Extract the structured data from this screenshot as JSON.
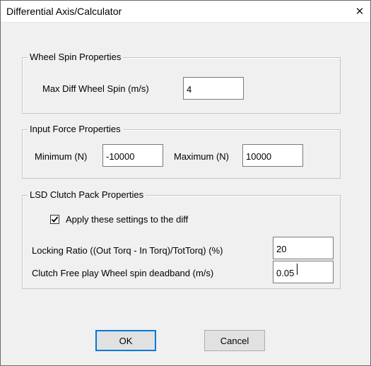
{
  "window": {
    "title": "Differential Axis/Calculator",
    "close_glyph": "✕"
  },
  "wheel_spin": {
    "legend": "Wheel Spin Properties",
    "max_diff_label": "Max Diff Wheel Spin (m/s)",
    "max_diff_value": "4"
  },
  "input_force": {
    "legend": "Input Force Properties",
    "minimum_label": "Minimum (N)",
    "minimum_value": "-10000",
    "maximum_label": "Maximum (N)",
    "maximum_value": "10000"
  },
  "lsd_clutch": {
    "legend": "LSD Clutch Pack Properties",
    "apply_label": "Apply these settings to the diff",
    "apply_checked": true,
    "locking_ratio_label": "Locking Ratio ((Out Torq - In Torq)/TotTorq) (%)",
    "locking_ratio_value": "20",
    "free_play_label": "Clutch Free play Wheel spin deadband (m/s)",
    "free_play_value": "0.05"
  },
  "buttons": {
    "ok_label": "OK",
    "cancel_label": "Cancel"
  }
}
